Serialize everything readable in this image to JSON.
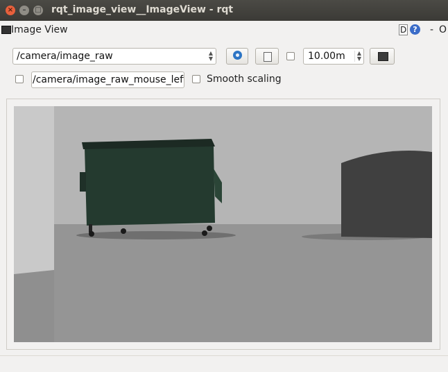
{
  "window": {
    "title": "rqt_image_view__ImageView - rqt",
    "controls": {
      "close": "×",
      "minimize": "–",
      "maximize": "□"
    }
  },
  "dock": {
    "title": "Image View",
    "d_label": "D",
    "help_label": "?",
    "minimize_label": "-",
    "close_label": "O"
  },
  "toolbar": {
    "topic_selected": "/camera/image_raw",
    "refresh_icon": "refresh-icon",
    "save_icon": "save-icon",
    "timeout_value": "10.00m",
    "capture_icon": "screen-icon"
  },
  "options": {
    "mouse_topic_value": "/camera/image_raw_mouse_left",
    "smooth_scaling_label": "Smooth scaling"
  },
  "colors": {
    "titlebar": "#3d3c38",
    "close_button": "#e8603c",
    "accent_blue": "#2d75c5"
  }
}
